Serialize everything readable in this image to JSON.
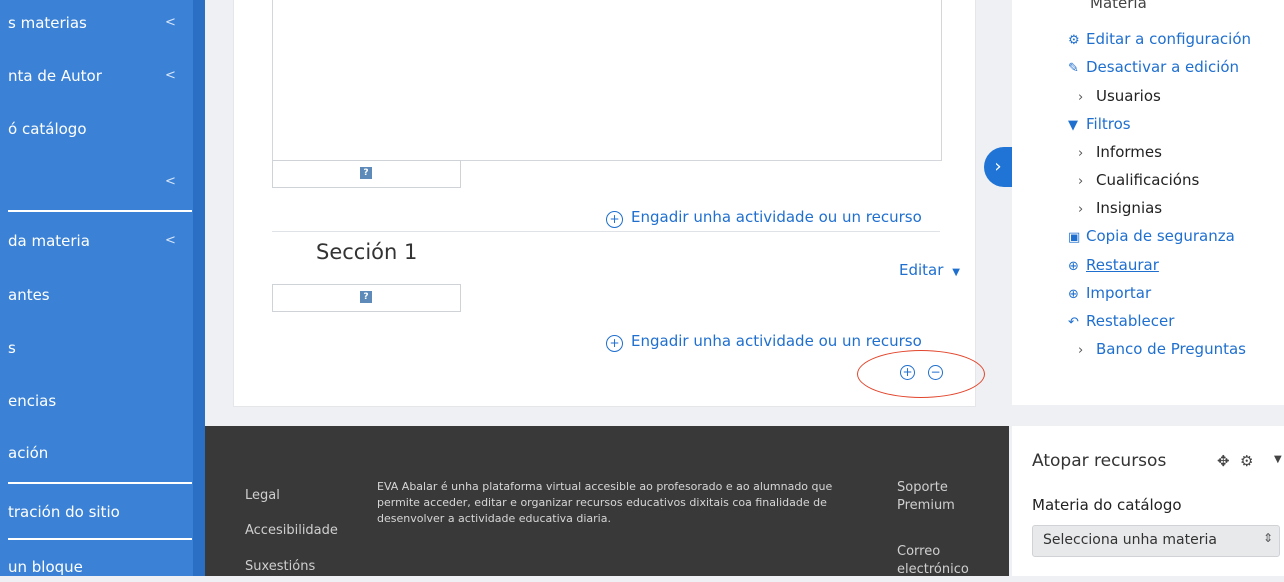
{
  "sidebar": {
    "items": [
      {
        "label": "s materias"
      },
      {
        "label": "nta de Autor"
      },
      {
        "label": "ó catálogo"
      },
      {
        "label": ""
      },
      {
        "label": "da materia"
      },
      {
        "label": "antes"
      },
      {
        "label": "s"
      },
      {
        "label": "encias"
      },
      {
        "label": "ación"
      },
      {
        "label": "tración do sitio"
      },
      {
        "label": "un bloque"
      }
    ]
  },
  "course": {
    "add_activity_label": "Engadir unha actividade ou un recurso",
    "section_title": "Sección 1",
    "edit_label": "Editar",
    "help_glyph": "?"
  },
  "admin": {
    "truncated_header": "Materia",
    "items": [
      {
        "label": "Editar a configuración",
        "icon": "gear-icon"
      },
      {
        "label": "Desactivar a edición",
        "icon": "pencil-icon"
      },
      {
        "label": "Usuarios",
        "icon": "chevron-right-icon"
      },
      {
        "label": "Filtros",
        "icon": "filter-icon"
      },
      {
        "label": "Informes",
        "icon": "chevron-right-icon"
      },
      {
        "label": "Cualificacións",
        "icon": "chevron-right-icon"
      },
      {
        "label": "Insignias",
        "icon": "chevron-right-icon"
      },
      {
        "label": "Copia de seguranza",
        "icon": "backup-icon"
      },
      {
        "label": "Restaurar",
        "icon": "restore-icon"
      },
      {
        "label": "Importar",
        "icon": "import-icon"
      },
      {
        "label": "Restablecer",
        "icon": "reset-icon"
      },
      {
        "label": "Banco de Preguntas",
        "icon": "chevron-right-icon"
      }
    ]
  },
  "footer": {
    "links": [
      "Legal",
      "Accesibilidade",
      "Suxestións"
    ],
    "description": "EVA Abalar é unha plataforma virtual accesible ao profesorado e ao alumnado que permite acceder, editar e organizar recursos educativos dixitais coa finalidade de desenvolver a actividade educativa diaria.",
    "support": "Soporte Premium",
    "email": "Correo electrónico"
  },
  "find_resources": {
    "title": "Atopar recursos",
    "catalog_label": "Materia do catálogo",
    "select_value": "Selecciona unha materia"
  },
  "colors": {
    "sidebar": "#3b82d6",
    "link": "#1f6fcf",
    "footer": "#3a3939",
    "highlight": "#e2452c"
  }
}
